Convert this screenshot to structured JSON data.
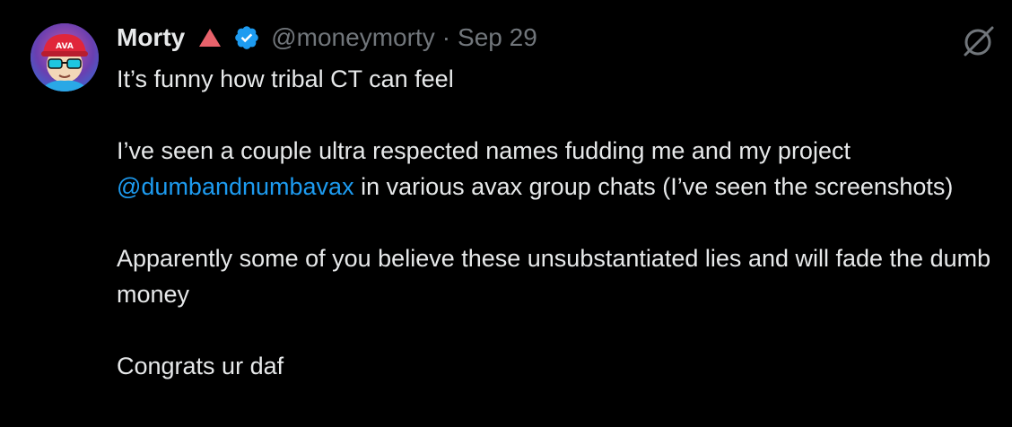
{
  "tweet": {
    "author": {
      "display_name": "Morty",
      "handle": "@moneymorty",
      "separator": "·",
      "date": "Sep 29",
      "name_emoji_icon": "red-triangle-icon",
      "verified_icon": "verified-badge-icon",
      "avatar_icon": "cartoon-avatar-icon"
    },
    "menu_icon": "grok-slash-circle-icon",
    "text": {
      "line1": "It’s funny how tribal CT can feel",
      "para2_before": "I’ve seen a couple ultra respected names fudding me and my project ",
      "para2_mention": "@dumbandnumbavax",
      "para2_after": " in various avax group chats (I’ve seen the screenshots)",
      "para3": "Apparently some of you believe these unsubstantiated lies and will fade the dumb money",
      "para4": "Congrats ur daf"
    }
  },
  "colors": {
    "background": "#000000",
    "text_primary": "#e7e9ea",
    "text_secondary": "#71767b",
    "link": "#1d9bf0",
    "verified": "#1d9bf0",
    "emoji_red": "#e8626b"
  }
}
